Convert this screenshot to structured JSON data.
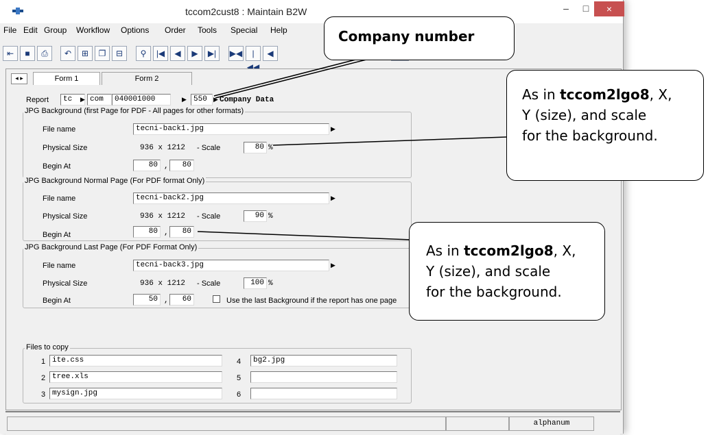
{
  "window": {
    "title": "tccom2cust8 : Maintain B2W",
    "minimize": "–",
    "maximize": "□",
    "close": "×"
  },
  "menu": [
    "File",
    "Edit",
    "Group",
    "Workflow",
    "Options",
    "Order",
    "Tools",
    "Special",
    "Help"
  ],
  "toolbar_icons": [
    "exit-icon",
    "save-icon",
    "print-icon",
    "undo-icon",
    "insert-icon",
    "copy-icon",
    "delete-icon",
    "find-icon",
    "first-record-icon",
    "previous-record-icon",
    "next-record-icon",
    "last-record-icon",
    "first-group-icon",
    "previous-group-icon",
    "previous-icon"
  ],
  "tabs": [
    "Form 1",
    "Form 2"
  ],
  "report": {
    "label": "Report",
    "package": "tc",
    "module": "com",
    "table": "040001000",
    "field": "550",
    "description": "Company Data"
  },
  "groups": [
    {
      "title": "JPG Background (first Page for PDF - All pages for other formats)",
      "file_label": "File name",
      "file": "tecni-back1.jpg",
      "size_label": "Physical Size",
      "size": "936 x 1212",
      "scale_label": "- Scale",
      "scale": "80",
      "percent": "%",
      "begin_label": "Begin At",
      "begin_x": "80",
      "begin_y": "80"
    },
    {
      "title": "JPG Background Normal Page (For PDF format Only)",
      "file_label": "File name",
      "file": "tecni-back2.jpg",
      "size_label": "Physical Size",
      "size": "936 x 1212",
      "scale_label": "- Scale",
      "scale": "90",
      "percent": "%",
      "begin_label": "Begin At",
      "begin_x": "80",
      "begin_y": "80"
    },
    {
      "title": "JPG Background Last Page (For PDF Format Only)",
      "file_label": "File name",
      "file": "tecni-back3.jpg",
      "size_label": "Physical Size",
      "size": "936 x 1212",
      "scale_label": "- Scale",
      "scale": "100",
      "percent": "%",
      "begin_label": "Begin At",
      "begin_x": "50",
      "begin_y": "60",
      "checkbox_label": "Use the last Background if the report has one page"
    }
  ],
  "files_to_copy": {
    "title": "Files to copy",
    "items": [
      {
        "n": "1",
        "v": "ite.css"
      },
      {
        "n": "2",
        "v": "tree.xls"
      },
      {
        "n": "3",
        "v": "mysign.jpg"
      },
      {
        "n": "4",
        "v": "bg2.jpg"
      },
      {
        "n": "5",
        "v": ""
      },
      {
        "n": "6",
        "v": ""
      }
    ]
  },
  "status": {
    "mode": "alphanum"
  },
  "callouts": {
    "company": "Company number",
    "scale_prefix": "As in ",
    "scale_bold": "tccom2lgo8",
    "scale_rest1": ", X,",
    "scale_line2": "Y (size), and scale",
    "scale_line3": "for the background."
  }
}
